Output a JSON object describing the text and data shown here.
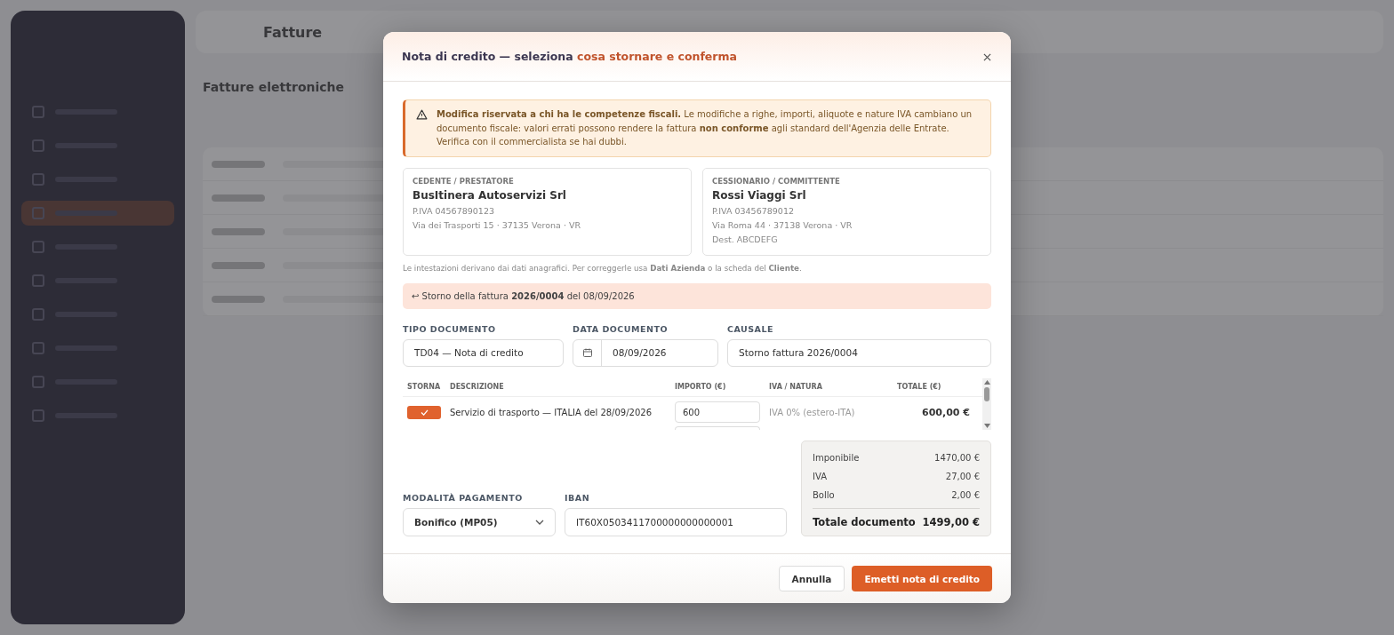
{
  "background": {
    "header_title": "Fatture",
    "section_title": "Fatture elettroniche",
    "sidebar_items": [
      {
        "selected": false
      },
      {
        "selected": false
      },
      {
        "selected": false
      },
      {
        "selected": true
      },
      {
        "selected": false
      },
      {
        "selected": false
      },
      {
        "selected": false
      },
      {
        "selected": false
      },
      {
        "selected": false
      },
      {
        "selected": false
      }
    ]
  },
  "dialog": {
    "title": "Nota di credito — seleziona ",
    "title_accent": "cosa stornare e conferma",
    "warning": "**Modifica riservata a chi ha le competenze fiscali.** Le modifiche a righe, importi, aliquote e nature IVA cambiano un documento fiscale: valori errati possono rendere la fattura **non conforme** agli standard dell'Agenzia delle Entrate. Verifica con il commercialista se hai dubbi.",
    "parties": [
      {
        "label": "CEDENTE / PRESTATORE",
        "name": "BusItinera Autoservizi Srl",
        "lines": [
          "P.IVA 04567890123",
          "Via dei Trasporti 15 · 37135 Verona · VR"
        ]
      },
      {
        "label": "CESSIONARIO / COMMITTENTE",
        "name": "Rossi Viaggi Srl",
        "lines": [
          "P.IVA 03456789012",
          "Via Roma 44 · 37138 Verona · VR",
          "Dest. ABCDEFG"
        ]
      }
    ],
    "note": "Le intestazioni derivano dai dati anagrafici. Per correggerle usa **Dati Azienda** o la scheda del **Cliente**.",
    "storno": "↩ Storno della fattura **2026/0004** del 08/09/2026",
    "fields": [
      {
        "label": "TIPO DOCUMENTO",
        "value": "TD04 — Nota di credito",
        "kind": "text"
      },
      {
        "label": "DATA DOCUMENTO",
        "value": "08/09/2026",
        "kind": "date"
      },
      {
        "label": "CAUSALE",
        "value": "Storno fattura 2026/0004",
        "kind": "text"
      }
    ],
    "table": {
      "columns": [
        "STORNA",
        "DESCRIZIONE",
        "IMPORTO (€)",
        "IVA / NATURA",
        "TOTALE (€)"
      ],
      "rows": [
        {
          "checked": true,
          "description": "Servizio di trasporto — ITALIA del 28/09/2026",
          "amount": "600",
          "vat": "IVA 0% (estero-ITA)",
          "total": "600,00 €"
        }
      ]
    },
    "payment": {
      "label": "MODALITÀ PAGAMENTO",
      "value": "Bonifico (MP05)"
    },
    "iban": {
      "label": "IBAN",
      "value": "IT60X0503411700000000000001"
    },
    "totals": [
      {
        "label": "Imponibile",
        "value": "1470,00 €"
      },
      {
        "label": "IVA",
        "value": "27,00 €"
      },
      {
        "label": "Bollo",
        "value": "2,00 €"
      }
    ],
    "grand_total": {
      "label": "Totale documento",
      "value": "1499,00 €"
    },
    "buttons": {
      "cancel": "Annulla",
      "confirm": "Emetti nota di credito"
    }
  }
}
